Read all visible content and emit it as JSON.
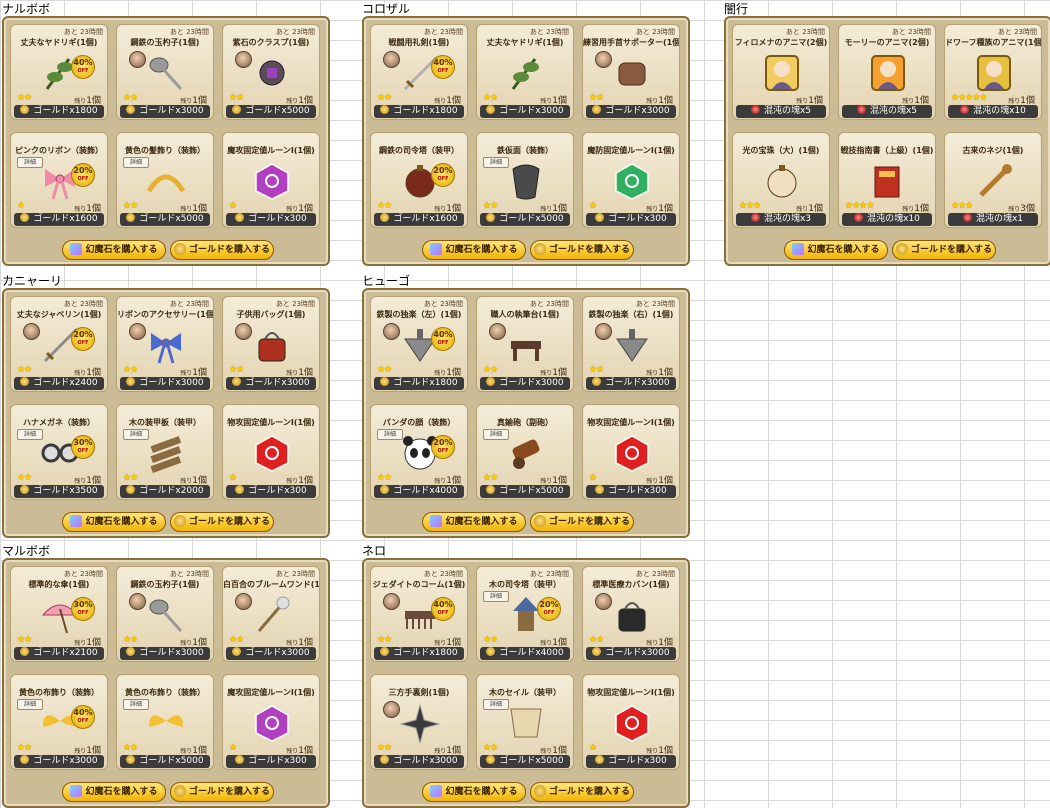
{
  "panels": [
    {
      "title": "ナルボボ",
      "items": [
        {
          "timer": "あと 23時間",
          "name": "丈夫なヤドリギ(1個)",
          "price": "ゴールドx1800",
          "stars": "★★",
          "remain": "1個",
          "discount": "40%",
          "detail": false,
          "art": "mistletoe",
          "color": "#5a8a3a",
          "portrait": false
        },
        {
          "timer": "あと 23時間",
          "name": "鋼鉄の玉杓子(1個)",
          "price": "ゴールドx3000",
          "stars": "★★",
          "remain": "1個",
          "discount": "",
          "detail": false,
          "art": "ladle",
          "color": "#9a9a9a",
          "portrait": true
        },
        {
          "timer": "あと 23時間",
          "name": "紫石のクラスプ(1個)",
          "price": "ゴールドx5000",
          "stars": "★★",
          "remain": "1個",
          "discount": "",
          "detail": false,
          "art": "clasp",
          "color": "#5a4a5a",
          "portrait": true
        },
        {
          "timer": "",
          "name": "ピンクのリボン（装飾）",
          "price": "ゴールドx1600",
          "stars": "★",
          "remain": "1個",
          "discount": "20%",
          "detail": true,
          "art": "ribbon",
          "color": "#f08aa8",
          "portrait": false
        },
        {
          "timer": "",
          "name": "黄色の髪飾り（装飾）",
          "price": "ゴールドx5000",
          "stars": "★★",
          "remain": "1個",
          "discount": "",
          "detail": true,
          "art": "hairpin",
          "color": "#e8b030",
          "portrait": false
        },
        {
          "timer": "",
          "name": "魔攻固定値ルーンⅠ(1個)",
          "price": "ゴールドx300",
          "stars": "★",
          "remain": "1個",
          "discount": "",
          "detail": false,
          "art": "rune",
          "color": "#b040c0",
          "portrait": false
        }
      ]
    },
    {
      "title": "コロザル",
      "items": [
        {
          "timer": "あと 23時間",
          "name": "戦闘用礼剣(1個)",
          "price": "ゴールドx1800",
          "stars": "★★",
          "remain": "1個",
          "discount": "40%",
          "detail": false,
          "art": "sword",
          "color": "#b0b0b0",
          "portrait": true
        },
        {
          "timer": "あと 23時間",
          "name": "丈夫なヤドリギ(1個)",
          "price": "ゴールドx3000",
          "stars": "★★",
          "remain": "1個",
          "discount": "",
          "detail": false,
          "art": "mistletoe",
          "color": "#5a8a3a",
          "portrait": false
        },
        {
          "timer": "あと 23時間",
          "name": "練習用手首サポーター(1個)",
          "price": "ゴールドx3000",
          "stars": "★★",
          "remain": "1個",
          "discount": "",
          "detail": false,
          "art": "wrist",
          "color": "#8a5a40",
          "portrait": true
        },
        {
          "timer": "",
          "name": "鋼鉄の司令塔（装甲）",
          "price": "ゴールドx1600",
          "stars": "★★",
          "remain": "1個",
          "discount": "20%",
          "detail": false,
          "art": "orb",
          "color": "#7a2a1a",
          "portrait": false
        },
        {
          "timer": "",
          "name": "鉄仮面（装飾）",
          "price": "ゴールドx5000",
          "stars": "★★",
          "remain": "1個",
          "discount": "",
          "detail": true,
          "art": "mask",
          "color": "#4a4a4a",
          "portrait": false
        },
        {
          "timer": "",
          "name": "魔防固定値ルーンⅠ(1個)",
          "price": "ゴールドx300",
          "stars": "★",
          "remain": "1個",
          "discount": "",
          "detail": false,
          "art": "rune",
          "color": "#30b060",
          "portrait": false
        }
      ]
    },
    {
      "title": "闇行",
      "items": [
        {
          "timer": "あと 23時間",
          "name": "フィロメナのアニマ(2個)",
          "price": "混沌の塊x5",
          "stars": "",
          "remain": "1個",
          "discount": "",
          "detail": false,
          "art": "anima",
          "color": "#f2cc60",
          "portrait": false,
          "red": true
        },
        {
          "timer": "あと 23時間",
          "name": "モーリーのアニマ(2個)",
          "price": "混沌の塊x5",
          "stars": "",
          "remain": "1個",
          "discount": "",
          "detail": false,
          "art": "anima",
          "color": "#f6a030",
          "portrait": false,
          "red": true
        },
        {
          "timer": "あと 23時間",
          "name": "ドワーフ種族のアニマ(1個)",
          "price": "混沌の塊x10",
          "stars": "★★★★★",
          "remain": "1個",
          "discount": "",
          "detail": false,
          "art": "anima",
          "color": "#e8c040",
          "portrait": false,
          "red": true
        },
        {
          "timer": "",
          "name": "光の宝珠（大）(1個)",
          "price": "混沌の塊x3",
          "stars": "★★★",
          "remain": "1個",
          "discount": "",
          "detail": false,
          "art": "orb",
          "color": "#f0e0c0",
          "portrait": false,
          "red": true
        },
        {
          "timer": "",
          "name": "戦技指南書（上級）(1個)",
          "price": "混沌の塊x10",
          "stars": "★★★★",
          "remain": "1個",
          "discount": "",
          "detail": false,
          "art": "book",
          "color": "#c03020",
          "portrait": false,
          "red": true
        },
        {
          "timer": "",
          "name": "古来のネジ(1個)",
          "price": "混沌の塊x1",
          "stars": "★★★",
          "remain": "3個",
          "discount": "",
          "detail": false,
          "art": "screw",
          "color": "#b07a30",
          "portrait": false,
          "red": true
        }
      ]
    },
    {
      "title": "カニャーリ",
      "items": [
        {
          "timer": "あと 23時間",
          "name": "丈夫なジャベリン(1個)",
          "price": "ゴールドx2400",
          "stars": "★★",
          "remain": "1個",
          "discount": "20%",
          "detail": false,
          "art": "sword",
          "color": "#8a8a8a",
          "portrait": true
        },
        {
          "timer": "あと 23時間",
          "name": "リボンのアクセサリー(1個)",
          "price": "ゴールドx3000",
          "stars": "★★",
          "remain": "1個",
          "discount": "",
          "detail": false,
          "art": "ribbon",
          "color": "#4a6ad0",
          "portrait": true
        },
        {
          "timer": "あと 23時間",
          "name": "子供用バッグ(1個)",
          "price": "ゴールドx3000",
          "stars": "★★",
          "remain": "1個",
          "discount": "",
          "detail": false,
          "art": "bag",
          "color": "#b03020",
          "portrait": true
        },
        {
          "timer": "",
          "name": "ハナメガネ（装飾）",
          "price": "ゴールドx3500",
          "stars": "★★",
          "remain": "1個",
          "discount": "30%",
          "detail": true,
          "art": "glasses",
          "color": "#3a3a3a",
          "portrait": false
        },
        {
          "timer": "",
          "name": "木の装甲板（装甲）",
          "price": "ゴールドx2000",
          "stars": "★★",
          "remain": "1個",
          "discount": "",
          "detail": true,
          "art": "wood",
          "color": "#8a6a40",
          "portrait": false
        },
        {
          "timer": "",
          "name": "物攻固定値ルーンⅠ(1個)",
          "price": "ゴールドx300",
          "stars": "★",
          "remain": "1個",
          "discount": "",
          "detail": false,
          "art": "rune",
          "color": "#e02020",
          "portrait": false
        }
      ]
    },
    {
      "title": "ヒューゴ",
      "items": [
        {
          "timer": "あと 23時間",
          "name": "鉄製の独楽（左）(1個)",
          "price": "ゴールドx1800",
          "stars": "★★",
          "remain": "1個",
          "discount": "40%",
          "detail": false,
          "art": "top",
          "color": "#8a8a8a",
          "portrait": true
        },
        {
          "timer": "あと 23時間",
          "name": "職人の執筆台(1個)",
          "price": "ゴールドx3000",
          "stars": "★★",
          "remain": "1個",
          "discount": "",
          "detail": false,
          "art": "desk",
          "color": "#5a3a2a",
          "portrait": true
        },
        {
          "timer": "あと 23時間",
          "name": "鉄製の独楽（右）(1個)",
          "price": "ゴールドx3000",
          "stars": "★★",
          "remain": "1個",
          "discount": "",
          "detail": false,
          "art": "top",
          "color": "#8a8a8a",
          "portrait": true
        },
        {
          "timer": "",
          "name": "パンダの顔（装飾）",
          "price": "ゴールドx4000",
          "stars": "★★",
          "remain": "1個",
          "discount": "20%",
          "detail": true,
          "art": "panda",
          "color": "#ffffff",
          "portrait": false
        },
        {
          "timer": "",
          "name": "真鍮砲（副砲）",
          "price": "ゴールドx5000",
          "stars": "★★",
          "remain": "1個",
          "discount": "",
          "detail": true,
          "art": "cannon",
          "color": "#8a4a20",
          "portrait": false
        },
        {
          "timer": "",
          "name": "物攻固定値ルーンⅠ(1個)",
          "price": "ゴールドx300",
          "stars": "★",
          "remain": "1個",
          "discount": "",
          "detail": false,
          "art": "rune",
          "color": "#e02020",
          "portrait": false
        }
      ]
    },
    {
      "title": "マルボボ",
      "items": [
        {
          "timer": "あと 23時間",
          "name": "標準的な傘(1個)",
          "price": "ゴールドx2100",
          "stars": "★★",
          "remain": "1個",
          "discount": "30%",
          "detail": false,
          "art": "umbrella",
          "color": "#f0a0b0",
          "portrait": false
        },
        {
          "timer": "あと 23時間",
          "name": "鋼鉄の玉杓子(1個)",
          "price": "ゴールドx3000",
          "stars": "★★",
          "remain": "1個",
          "discount": "",
          "detail": false,
          "art": "ladle",
          "color": "#9a9a9a",
          "portrait": true
        },
        {
          "timer": "あと 23時間",
          "name": "白百合のブルームワンド(1個)",
          "price": "ゴールドx3000",
          "stars": "★★",
          "remain": "1個",
          "discount": "",
          "detail": false,
          "art": "wand",
          "color": "#e0e0e0",
          "portrait": true
        },
        {
          "timer": "",
          "name": "黄色の布飾り（装飾）",
          "price": "ゴールドx3000",
          "stars": "★★",
          "remain": "1個",
          "discount": "40%",
          "detail": true,
          "art": "wings",
          "color": "#f2c030",
          "portrait": false
        },
        {
          "timer": "",
          "name": "黄色の布飾り（装飾）",
          "price": "ゴールドx5000",
          "stars": "★★",
          "remain": "1個",
          "discount": "",
          "detail": true,
          "art": "wings",
          "color": "#f2c030",
          "portrait": false
        },
        {
          "timer": "",
          "name": "魔攻固定値ルーンⅠ(1個)",
          "price": "ゴールドx300",
          "stars": "★",
          "remain": "1個",
          "discount": "",
          "detail": false,
          "art": "rune",
          "color": "#b040c0",
          "portrait": false
        }
      ]
    },
    {
      "title": "ネロ",
      "items": [
        {
          "timer": "あと 23時間",
          "name": "ジェダイトのコーム(1個)",
          "price": "ゴールドx1800",
          "stars": "★★",
          "remain": "1個",
          "discount": "40%",
          "detail": false,
          "art": "comb",
          "color": "#6a4a3a",
          "portrait": true
        },
        {
          "timer": "あと 23時間",
          "name": "木の司令塔（装甲）",
          "price": "ゴールドx4000",
          "stars": "★★",
          "remain": "1個",
          "discount": "20%",
          "detail": true,
          "art": "tower",
          "color": "#4a6aa0",
          "portrait": false
        },
        {
          "timer": "あと 23時間",
          "name": "標準医療カバン(1個)",
          "price": "ゴールドx3000",
          "stars": "★★",
          "remain": "1個",
          "discount": "",
          "detail": false,
          "art": "bag",
          "color": "#2a2a2a",
          "portrait": true
        },
        {
          "timer": "",
          "name": "三方手裏剣(1個)",
          "price": "ゴールドx3000",
          "stars": "★★",
          "remain": "1個",
          "discount": "",
          "detail": false,
          "art": "shuriken",
          "color": "#3a3a3a",
          "portrait": true
        },
        {
          "timer": "",
          "name": "木のセイル（装甲）",
          "price": "ゴールドx5000",
          "stars": "★★",
          "remain": "1個",
          "discount": "",
          "detail": true,
          "art": "sail",
          "color": "#e8d8b0",
          "portrait": false
        },
        {
          "timer": "",
          "name": "物攻固定値ルーンⅠ(1個)",
          "price": "ゴールドx300",
          "stars": "★",
          "remain": "1個",
          "discount": "",
          "detail": false,
          "art": "rune",
          "color": "#e02020",
          "portrait": false
        }
      ]
    }
  ],
  "labels": {
    "detail": "詳細",
    "remain_prefix": "残り",
    "off": "OFF",
    "buy_gem": "幻魔石を購入する",
    "buy_gold": "ゴールドを購入する"
  }
}
